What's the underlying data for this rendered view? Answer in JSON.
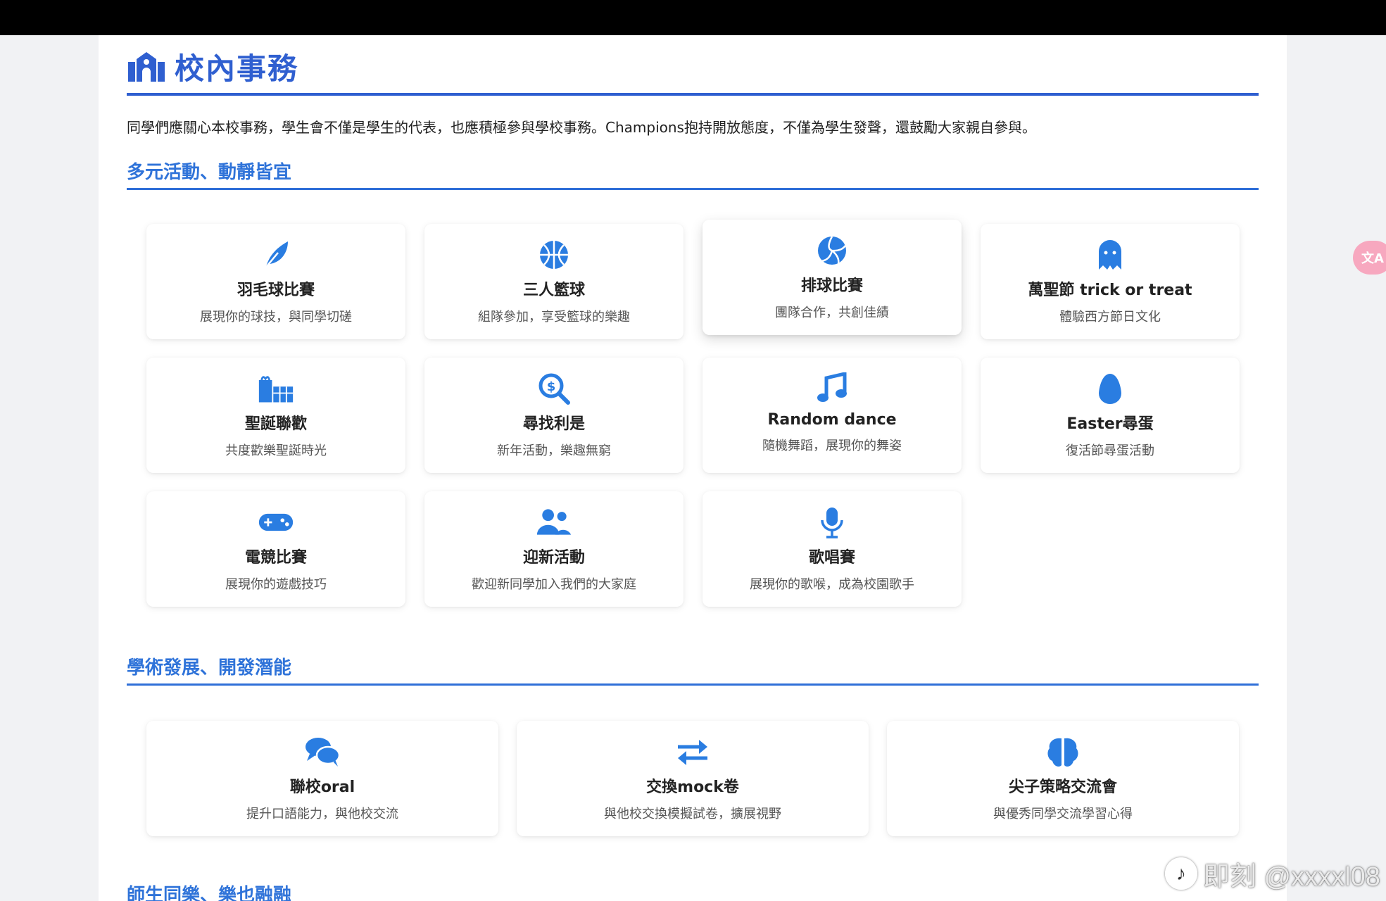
{
  "header": {
    "title": "校內事務",
    "icon": "school-icon"
  },
  "intro": "同學們應關心本校事務，學生會不僅是學生的代表，也應積極參與學校事務。Champions抱持開放態度，不僅為學生發聲，還鼓勵大家親自參與。",
  "sections": [
    {
      "title": "多元活動、動靜皆宜",
      "cards": [
        {
          "icon": "feather-icon",
          "title": "羽毛球比賽",
          "desc": "展現你的球技，與同學切磋"
        },
        {
          "icon": "basketball-icon",
          "title": "三人籃球",
          "desc": "組隊參加，享受籃球的樂趣"
        },
        {
          "icon": "volleyball-icon",
          "title": "排球比賽",
          "desc": "團隊合作，共創佳績"
        },
        {
          "icon": "ghost-icon",
          "title": "萬聖節 trick or treat",
          "desc": "體驗西方節日文化"
        },
        {
          "icon": "gifts-icon",
          "title": "聖誕聯歡",
          "desc": "共度歡樂聖誕時光"
        },
        {
          "icon": "search-dollar-icon",
          "title": "尋找利是",
          "desc": "新年活動，樂趣無窮"
        },
        {
          "icon": "music-icon",
          "title": "Random dance",
          "desc": "隨機舞蹈，展現你的舞姿"
        },
        {
          "icon": "egg-icon",
          "title": "Easter尋蛋",
          "desc": "復活節尋蛋活動"
        },
        {
          "icon": "gamepad-icon",
          "title": "電競比賽",
          "desc": "展現你的遊戲技巧"
        },
        {
          "icon": "users-icon",
          "title": "迎新活動",
          "desc": "歡迎新同學加入我們的大家庭"
        },
        {
          "icon": "microphone-icon",
          "title": "歌唱賽",
          "desc": "展現你的歌喉，成為校園歌手"
        }
      ]
    },
    {
      "title": "學術發展、開發潛能",
      "cards": [
        {
          "icon": "comments-icon",
          "title": "聯校oral",
          "desc": "提升口語能力，與他校交流"
        },
        {
          "icon": "exchange-icon",
          "title": "交換mock卷",
          "desc": "與他校交換模擬試卷，擴展視野"
        },
        {
          "icon": "brain-icon",
          "title": "尖子策略交流會",
          "desc": "與優秀同學交流學習心得"
        }
      ]
    },
    {
      "title": "師生同樂、樂也融融"
    }
  ],
  "translate_button": {
    "label": "文A",
    "icon": "translate-icon"
  },
  "watermark": {
    "icon": "tiktok-icon",
    "text": "即刻 @xxxxl08"
  },
  "colors": {
    "primary": "#2f5fd0",
    "icon_blue": "#2a7de1",
    "section_blue": "#2f73d9"
  }
}
